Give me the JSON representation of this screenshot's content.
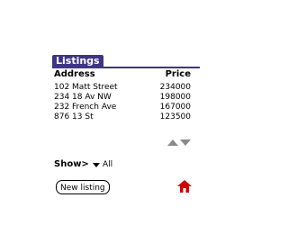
{
  "title": "Listings",
  "columns": {
    "address": "Address",
    "price": "Price"
  },
  "rows": [
    {
      "address": "102 Matt Street",
      "price": "234000"
    },
    {
      "address": "234 18 Av NW",
      "price": "198000"
    },
    {
      "address": "232 French Ave",
      "price": "167000"
    },
    {
      "address": "876 13 St",
      "price": "123500"
    }
  ],
  "filter": {
    "label": "Show>",
    "value": "All"
  },
  "buttons": {
    "new_listing": "New listing"
  },
  "icons": {
    "scroll_up": "scroll-up-icon",
    "scroll_down": "scroll-down-icon",
    "home": "home-icon",
    "dropdown": "dropdown-triangle-icon"
  },
  "colors": {
    "title_bar": "#3f3583",
    "home_icon": "#d40000",
    "scroll_arrows": "#8a8a8a"
  }
}
